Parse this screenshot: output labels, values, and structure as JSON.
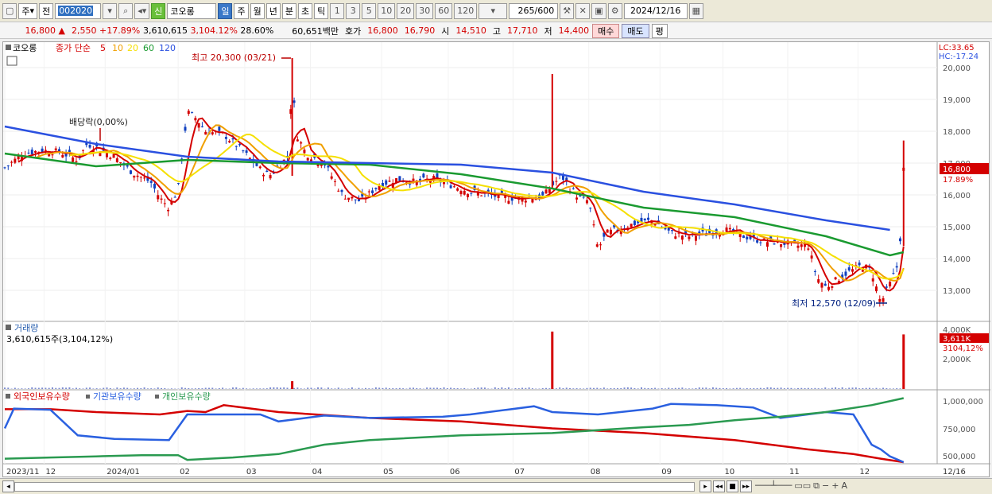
{
  "toolbar": {
    "type_main": "주",
    "type_prev": "전",
    "code": "002020",
    "shin": "신",
    "name": "코오롱",
    "periods": [
      "일",
      "주",
      "월",
      "년",
      "분",
      "초",
      "틱"
    ],
    "minutes": [
      "1",
      "3",
      "5",
      "10",
      "20",
      "30",
      "60",
      "120"
    ],
    "count": "265",
    "count_total": "/600",
    "date": "2024/12/16"
  },
  "quote": {
    "price": "16,800",
    "arrow": "▲",
    "change": "2,550",
    "change_pct": "+17.89%",
    "volume": "3,610,615",
    "volume_pct": "3,104.12%",
    "turnover": "28.60%",
    "amount": "60,651백만",
    "hoga_label": "호가",
    "ask": "16,800",
    "bid": "16,790",
    "open_label": "시",
    "open": "14,510",
    "high_label": "고",
    "high": "17,710",
    "low_label": "저",
    "low": "14,400",
    "buy": "매수",
    "sell": "매도",
    "avg": "평"
  },
  "price_panel": {
    "stock_name": "코오롱",
    "ma_title": "종가 단순",
    "ma_periods": [
      "5",
      "10",
      "20",
      "60",
      "120"
    ],
    "ma_colors": [
      "#d40000",
      "#f0a000",
      "#f5e000",
      "#1a9a30",
      "#2a50e0"
    ],
    "high_note": "최고 20,300 (03/21)",
    "low_note": "최저 12,570 (12/09)",
    "dividend_note": "배당락(0,00%)",
    "lc": "LC:33.65",
    "hc": "HC:-17.24",
    "y_ticks": [
      "20,000",
      "19,000",
      "18,000",
      "17,000",
      "16,000",
      "15,000",
      "14,000",
      "13,000"
    ],
    "last_price": "16,800",
    "last_pct": "17.89%"
  },
  "volume_panel": {
    "title": "거래량",
    "value": "3,610,615주(3,104,12%)",
    "y_ticks": [
      "4,000K",
      "2,000K"
    ],
    "last_value": "3,611K",
    "last_pct": "3104,12%"
  },
  "holding_panel": {
    "series": [
      "외국인보유수량",
      "기관보유수량",
      "개인보유수량"
    ],
    "series_colors": [
      "#d40000",
      "#2a60e0",
      "#2a9a50"
    ],
    "y_ticks": [
      "1,000,000",
      "750,000",
      "500,000"
    ]
  },
  "x_axis": {
    "labels": [
      "2023/11",
      "12",
      "2024/01",
      "02",
      "03",
      "04",
      "05",
      "06",
      "07",
      "08",
      "09",
      "10",
      "11",
      "12"
    ],
    "last_label": "12/16"
  },
  "chart_data": {
    "type": "candlestick",
    "price_range": [
      12300,
      20300
    ],
    "volume_range": [
      0,
      4000000
    ],
    "holding_range": [
      470000,
      1030000
    ],
    "close_path": [
      [
        0,
        16850
      ],
      [
        0.02,
        17300
      ],
      [
        0.04,
        17400
      ],
      [
        0.06,
        17350
      ],
      [
        0.08,
        17100
      ],
      [
        0.09,
        17600
      ],
      [
        0.1,
        17500
      ],
      [
        0.12,
        17200
      ],
      [
        0.14,
        16700
      ],
      [
        0.16,
        16400
      ],
      [
        0.17,
        15900
      ],
      [
        0.18,
        15600
      ],
      [
        0.19,
        16200
      ],
      [
        0.2,
        18600
      ],
      [
        0.21,
        18400
      ],
      [
        0.22,
        18000
      ],
      [
        0.24,
        17900
      ],
      [
        0.26,
        17400
      ],
      [
        0.28,
        16800
      ],
      [
        0.29,
        16600
      ],
      [
        0.3,
        16900
      ],
      [
        0.31,
        17200
      ],
      [
        0.315,
        19500
      ],
      [
        0.32,
        17900
      ],
      [
        0.33,
        17300
      ],
      [
        0.35,
        17000
      ],
      [
        0.37,
        16000
      ],
      [
        0.39,
        15800
      ],
      [
        0.41,
        16300
      ],
      [
        0.43,
        16500
      ],
      [
        0.45,
        16400
      ],
      [
        0.47,
        16500
      ],
      [
        0.49,
        16300
      ],
      [
        0.51,
        16100
      ],
      [
        0.53,
        16000
      ],
      [
        0.55,
        15900
      ],
      [
        0.57,
        15900
      ],
      [
        0.59,
        15950
      ],
      [
        0.6,
        16300
      ],
      [
        0.61,
        16600
      ],
      [
        0.62,
        16200
      ],
      [
        0.63,
        15900
      ],
      [
        0.64,
        15800
      ],
      [
        0.65,
        14300
      ],
      [
        0.66,
        14800
      ],
      [
        0.67,
        14900
      ],
      [
        0.69,
        15100
      ],
      [
        0.71,
        15200
      ],
      [
        0.73,
        14800
      ],
      [
        0.75,
        14700
      ],
      [
        0.77,
        14800
      ],
      [
        0.79,
        14900
      ],
      [
        0.81,
        14700
      ],
      [
        0.83,
        14550
      ],
      [
        0.85,
        14500
      ],
      [
        0.87,
        14400
      ],
      [
        0.88,
        14450
      ],
      [
        0.89,
        13400
      ],
      [
        0.9,
        13100
      ],
      [
        0.92,
        13500
      ],
      [
        0.94,
        13800
      ],
      [
        0.95,
        13600
      ],
      [
        0.96,
        12600
      ],
      [
        0.97,
        13200
      ],
      [
        0.98,
        13900
      ],
      [
        0.985,
        16800
      ]
    ],
    "ma120_path": [
      [
        0,
        18150
      ],
      [
        0.1,
        17600
      ],
      [
        0.2,
        17200
      ],
      [
        0.3,
        17050
      ],
      [
        0.4,
        17000
      ],
      [
        0.5,
        16950
      ],
      [
        0.6,
        16700
      ],
      [
        0.7,
        16100
      ],
      [
        0.8,
        15700
      ],
      [
        0.9,
        15200
      ],
      [
        0.97,
        14900
      ]
    ],
    "ma60_path": [
      [
        0,
        17300
      ],
      [
        0.1,
        16900
      ],
      [
        0.2,
        17100
      ],
      [
        0.3,
        17000
      ],
      [
        0.4,
        16950
      ],
      [
        0.5,
        16650
      ],
      [
        0.6,
        16200
      ],
      [
        0.7,
        15600
      ],
      [
        0.8,
        15300
      ],
      [
        0.9,
        14700
      ],
      [
        0.97,
        14100
      ],
      [
        0.985,
        14200
      ]
    ],
    "volume_spikes": [
      [
        0.315,
        520000
      ],
      [
        0.6,
        3800000
      ],
      [
        0.985,
        3610615
      ]
    ],
    "foreign_path": [
      [
        0,
        925000
      ],
      [
        0.05,
        925000
      ],
      [
        0.1,
        900000
      ],
      [
        0.17,
        880000
      ],
      [
        0.2,
        910000
      ],
      [
        0.22,
        900000
      ],
      [
        0.24,
        960000
      ],
      [
        0.3,
        900000
      ],
      [
        0.4,
        850000
      ],
      [
        0.5,
        820000
      ],
      [
        0.6,
        760000
      ],
      [
        0.65,
        740000
      ],
      [
        0.7,
        720000
      ],
      [
        0.8,
        660000
      ],
      [
        0.88,
        580000
      ],
      [
        0.93,
        540000
      ],
      [
        0.96,
        500000
      ],
      [
        0.985,
        470000
      ]
    ],
    "inst_path": [
      [
        0,
        760000
      ],
      [
        0.01,
        930000
      ],
      [
        0.05,
        920000
      ],
      [
        0.08,
        700000
      ],
      [
        0.12,
        670000
      ],
      [
        0.18,
        660000
      ],
      [
        0.2,
        880000
      ],
      [
        0.28,
        880000
      ],
      [
        0.3,
        820000
      ],
      [
        0.35,
        870000
      ],
      [
        0.4,
        850000
      ],
      [
        0.48,
        860000
      ],
      [
        0.51,
        880000
      ],
      [
        0.55,
        920000
      ],
      [
        0.58,
        950000
      ],
      [
        0.6,
        900000
      ],
      [
        0.65,
        880000
      ],
      [
        0.71,
        930000
      ],
      [
        0.73,
        970000
      ],
      [
        0.78,
        960000
      ],
      [
        0.82,
        940000
      ],
      [
        0.85,
        850000
      ],
      [
        0.9,
        900000
      ],
      [
        0.93,
        880000
      ],
      [
        0.95,
        620000
      ],
      [
        0.96,
        580000
      ],
      [
        0.97,
        520000
      ],
      [
        0.985,
        470000
      ]
    ],
    "indiv_path": [
      [
        0,
        500000
      ],
      [
        0.05,
        510000
      ],
      [
        0.1,
        520000
      ],
      [
        0.15,
        530000
      ],
      [
        0.19,
        530000
      ],
      [
        0.2,
        490000
      ],
      [
        0.25,
        510000
      ],
      [
        0.3,
        540000
      ],
      [
        0.35,
        620000
      ],
      [
        0.4,
        660000
      ],
      [
        0.5,
        700000
      ],
      [
        0.6,
        720000
      ],
      [
        0.7,
        770000
      ],
      [
        0.75,
        790000
      ],
      [
        0.8,
        830000
      ],
      [
        0.85,
        860000
      ],
      [
        0.9,
        900000
      ],
      [
        0.95,
        960000
      ],
      [
        0.985,
        1020000
      ]
    ]
  }
}
